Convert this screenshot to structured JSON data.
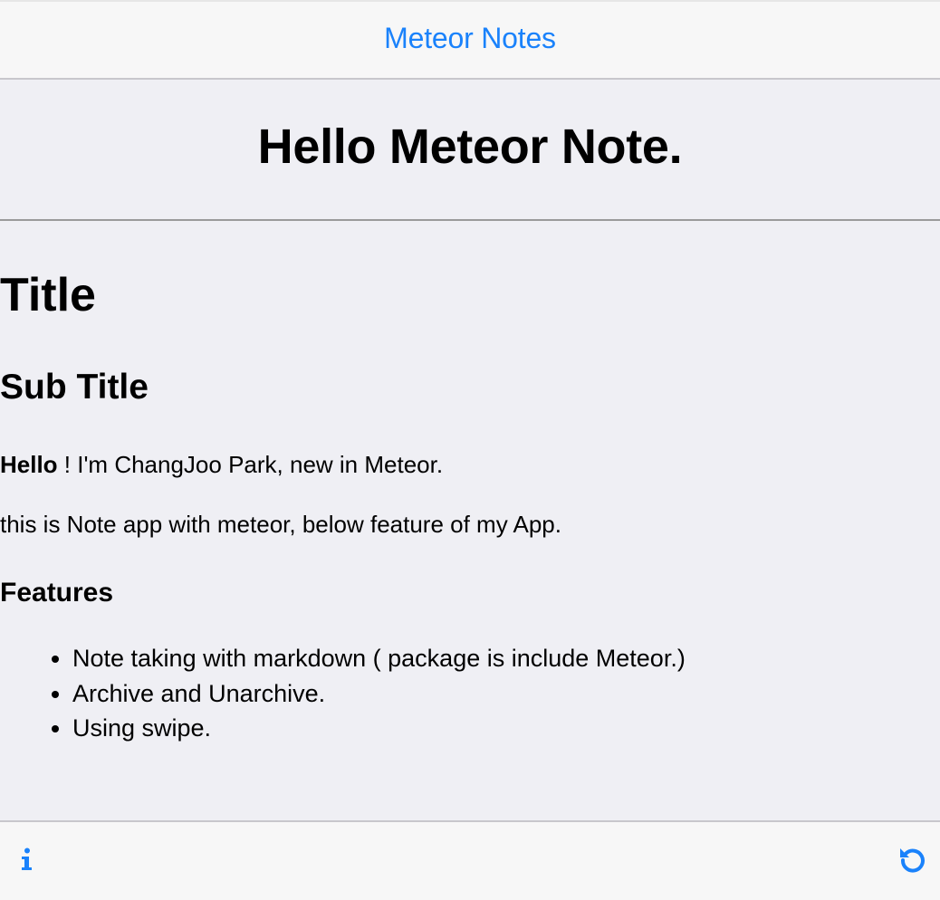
{
  "navbar": {
    "title": "Meteor Notes"
  },
  "note": {
    "title": "Hello Meteor Note."
  },
  "content": {
    "h1": "Title",
    "h2": "Sub Title",
    "p1_bold": "Hello",
    "p1_rest": " ! I'm ChangJoo Park, new in Meteor.",
    "p2": "this is Note app with meteor, below feature of my App.",
    "h3": "Features",
    "features": [
      "Note taking with markdown ( package is include Meteor.)",
      "Archive and Unarchive.",
      "Using swipe."
    ]
  },
  "toolbar": {
    "left_icon": "info-icon",
    "right_icon": "refresh-icon"
  },
  "colors": {
    "accent": "#1a82fb",
    "background": "#efeff4",
    "bar_background": "#f7f7f7"
  }
}
